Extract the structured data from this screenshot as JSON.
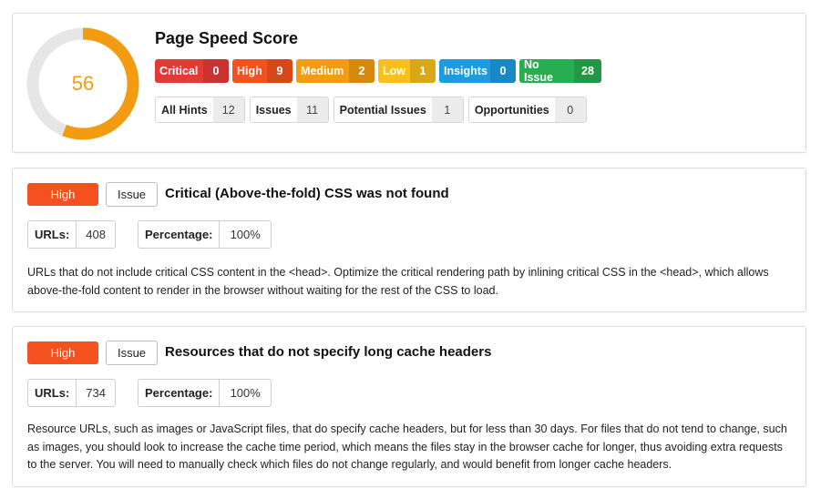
{
  "score": {
    "value": 56,
    "fraction": 0.56,
    "title": "Page Speed Score",
    "colors": {
      "arc": "#f39c12",
      "track": "#e6e6e6"
    }
  },
  "severities": [
    {
      "label": "Critical",
      "count": "0",
      "color": "#e53935"
    },
    {
      "label": "High",
      "count": "9",
      "color": "#f4511e"
    },
    {
      "label": "Medium",
      "count": "2",
      "color": "#f39c12"
    },
    {
      "label": "Low",
      "count": "1",
      "color": "#f9c01a"
    },
    {
      "label": "Insights",
      "count": "0",
      "color": "#1e9be0"
    },
    {
      "label": "No Issue",
      "count": "28",
      "color": "#27ae50"
    }
  ],
  "hints": [
    {
      "label": "All Hints",
      "count": "12"
    },
    {
      "label": "Issues",
      "count": "11"
    },
    {
      "label": "Potential Issues",
      "count": "1"
    },
    {
      "label": "Opportunities",
      "count": "0"
    }
  ],
  "issues": [
    {
      "priority": "High",
      "type": "Issue",
      "title": "Critical (Above-the-fold) CSS was not found",
      "urls_label": "URLs:",
      "urls": "408",
      "percentage_label": "Percentage:",
      "percentage": "100%",
      "description": "URLs that do not include critical CSS content in the <head>. Optimize the critical rendering path by inlining critical CSS in the <head>, which allows above-the-fold content to render in the browser without waiting for the rest of the CSS to load."
    },
    {
      "priority": "High",
      "type": "Issue",
      "title": "Resources that do not specify long cache headers",
      "urls_label": "URLs:",
      "urls": "734",
      "percentage_label": "Percentage:",
      "percentage": "100%",
      "description": "Resource URLs, such as images or JavaScript files, that do specify cache headers, but for less than 30 days. For files that do not tend to change, such as images, you should look to increase the cache time period, which means the files stay in the browser cache for longer, thus avoiding extra requests to the server. You will need to manually check which files do not change regularly, and would benefit from longer cache headers."
    }
  ]
}
